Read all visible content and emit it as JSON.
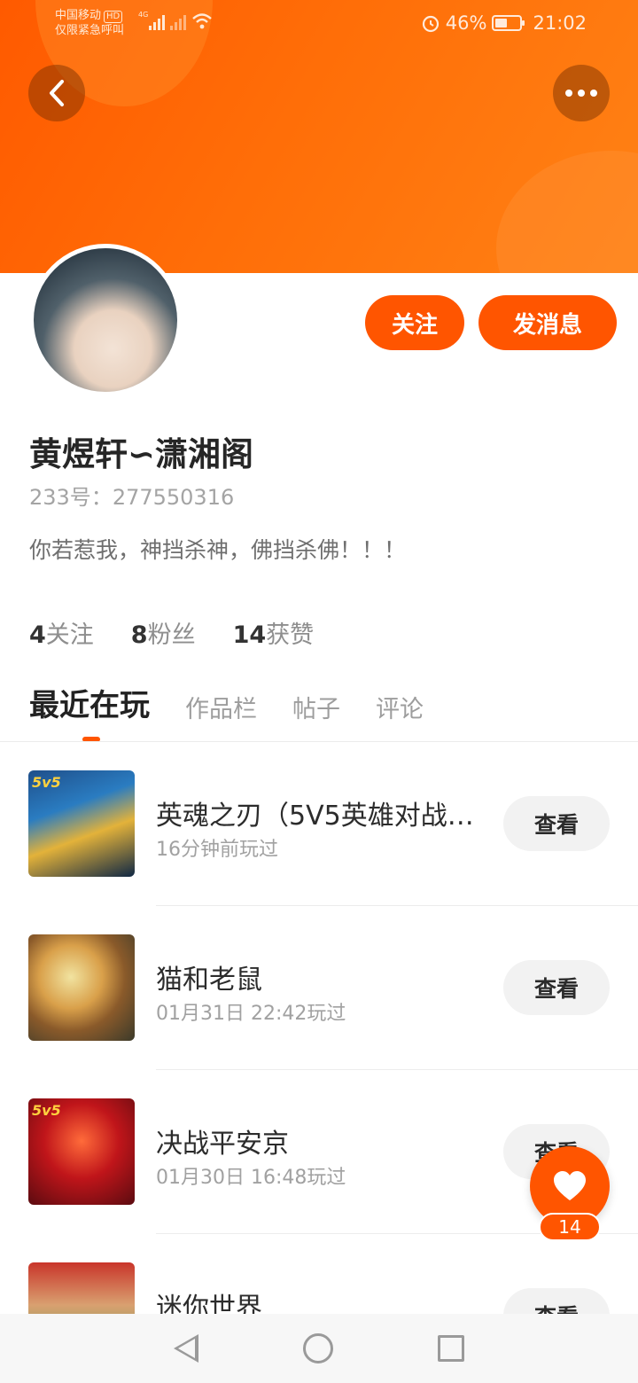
{
  "status_bar": {
    "carrier": "中国移动",
    "hd": "HD",
    "emergency": "仅限紧急呼叫",
    "network": "4G",
    "battery": "46%",
    "time": "21:02"
  },
  "profile": {
    "name": "黄煜轩∽潇湘阁",
    "uid_label": "233号：",
    "uid": "277550316",
    "bio": "你若惹我，神挡杀神，佛挡杀佛！！！",
    "follow_button": "关注",
    "message_button": "发消息",
    "stats": [
      {
        "value": "4",
        "label": "关注"
      },
      {
        "value": "8",
        "label": "粉丝"
      },
      {
        "value": "14",
        "label": "获赞"
      }
    ]
  },
  "tabs": [
    "最近在玩",
    "作品栏",
    "帖子",
    "评论"
  ],
  "games": [
    {
      "title": "英魂之刃（5V5英雄对战…",
      "time": "16分钟前玩过",
      "button": "查看",
      "badge": "5v5"
    },
    {
      "title": "猫和老鼠",
      "time": "01月31日 22:42玩过",
      "button": "查看"
    },
    {
      "title": "决战平安京",
      "time": "01月30日 16:48玩过",
      "button": "查看",
      "badge": "5v5"
    },
    {
      "title": "迷你世界",
      "time": "",
      "button": "查看"
    }
  ],
  "like_count": "14",
  "colors": {
    "accent": "#ff5500",
    "banner": "#ff6e08"
  }
}
